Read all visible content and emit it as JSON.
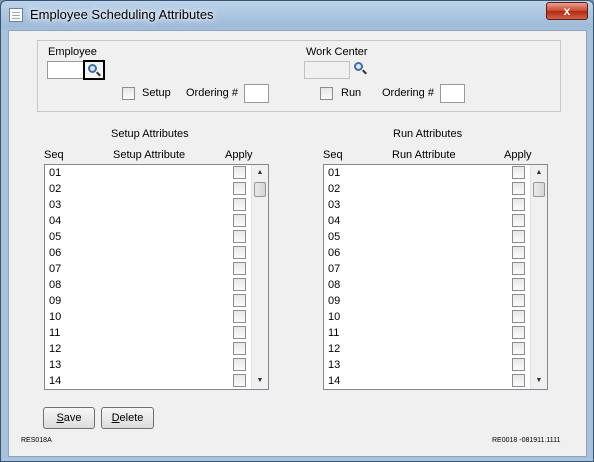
{
  "window": {
    "title": "Employee Scheduling Attributes",
    "close_glyph": "x"
  },
  "header": {
    "employee_label": "Employee",
    "employee_value": "",
    "work_center_label": "Work Center",
    "work_center_value": "",
    "setup_label": "Setup",
    "setup_ordering_label": "Ordering #",
    "setup_ordering_value": "",
    "run_label": "Run",
    "run_ordering_label": "Ordering #",
    "run_ordering_value": ""
  },
  "setup_panel": {
    "title": "Setup Attributes",
    "col_seq": "Seq",
    "col_attr": "Setup Attribute",
    "col_apply": "Apply",
    "rows": [
      "01",
      "02",
      "03",
      "04",
      "05",
      "06",
      "07",
      "08",
      "09",
      "10",
      "11",
      "12",
      "13",
      "14"
    ]
  },
  "run_panel": {
    "title": "Run Attributes",
    "col_seq": "Seq",
    "col_attr": "Run Attribute",
    "col_apply": "Apply",
    "rows": [
      "01",
      "02",
      "03",
      "04",
      "05",
      "06",
      "07",
      "08",
      "09",
      "10",
      "11",
      "12",
      "13",
      "14"
    ]
  },
  "buttons": {
    "save_hotkey": "S",
    "save_rest": "ave",
    "delete_hotkey": "D",
    "delete_rest": "elete"
  },
  "footer": {
    "left_code": "RES018A",
    "right_code": "RE0018 -081911.1111"
  },
  "icons": {
    "lookup": "magnifier-icon",
    "scroll_up": "scroll-up-arrow-icon",
    "scroll_down": "scroll-down-arrow-icon"
  },
  "colors": {
    "titlebar": "#a9c2dc",
    "client": "#f0f0f0",
    "close": "#c9472d"
  }
}
